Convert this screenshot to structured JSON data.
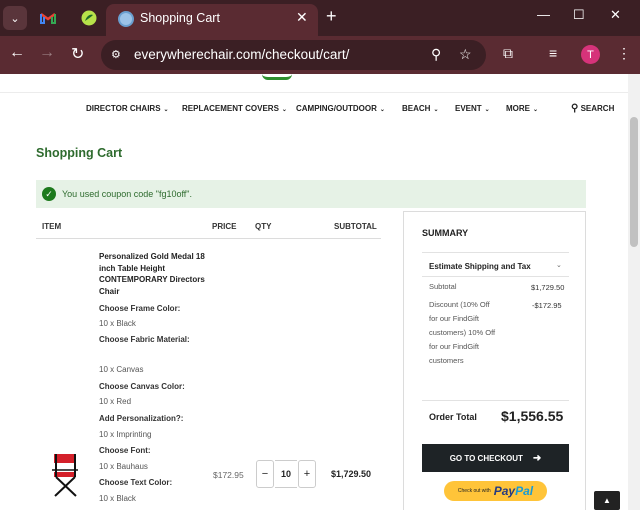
{
  "browser": {
    "tab_title": "Shopping Cart",
    "url": "everywherechair.com/checkout/cart/",
    "profile_initial": "T",
    "icons": [
      "tab-search-icon",
      "gmail-icon",
      "findgift-icon",
      "site-favicon",
      "close-icon",
      "new-tab-icon",
      "minimize-icon",
      "maximize-icon",
      "window-close-icon",
      "back-icon",
      "forward-icon",
      "reload-icon",
      "site-info-icon",
      "zoom-icon",
      "bookmark-star-icon",
      "extensions-icon",
      "media-icon",
      "menu-icon"
    ]
  },
  "nav": {
    "items": [
      "DIRECTOR CHAIRS",
      "REPLACEMENT COVERS",
      "CAMPING/OUTDOOR",
      "BEACH",
      "EVENT",
      "MORE"
    ],
    "search": "SEARCH"
  },
  "page": {
    "title": "Shopping Cart",
    "notice": "You used coupon code \"fg10off\"."
  },
  "table": {
    "headers": [
      "ITEM",
      "PRICE",
      "QTY",
      "SUBTOTAL"
    ],
    "item": {
      "name": "Personalized Gold Medal 18 inch Table Height CONTEMPORARY Directors Chair",
      "options": [
        {
          "label": "Choose Frame Color:",
          "value": "10 x Black"
        },
        {
          "label": "Choose Fabric Material:",
          "value": "10 x Canvas"
        },
        {
          "label": "Choose Canvas Color:",
          "value": "10 x Red"
        },
        {
          "label": "Add Personalization?:",
          "value": "10 x Imprinting"
        },
        {
          "label": "Choose Font:",
          "value": "10 x Bauhaus"
        },
        {
          "label": "Choose Text Color:",
          "value": "10 x Black"
        }
      ],
      "price": "$172.95",
      "qty": "10",
      "qty_minus": "−",
      "qty_plus": "+",
      "subtotal": "$1,729.50"
    }
  },
  "summary": {
    "title": "SUMMARY",
    "estimate": "Estimate Shipping and Tax",
    "subtotal_label": "Subtotal",
    "subtotal_value": "$1,729.50",
    "discount_label": "Discount (10% Off for our FindGift customers) 10% Off for our FindGift customers",
    "discount_value": "-$172.95",
    "order_total_label": "Order Total",
    "order_total_value": "$1,556.55",
    "checkout_label": "GO TO CHECKOUT",
    "paypal_small": "Check out with",
    "paypal_logo_a": "Pay",
    "paypal_logo_b": "Pal"
  },
  "colors": {
    "title_green": "#2e6b2e",
    "notice_bg": "#e6f2e6",
    "chrome": "#3b1f24",
    "toolbar": "#5a2b32",
    "paypal": "#ffc439"
  }
}
